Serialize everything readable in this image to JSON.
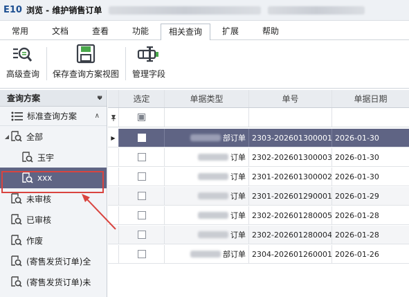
{
  "window": {
    "app_logo": "E10",
    "title": "浏览 - 维护销售订单"
  },
  "tabs": [
    "常用",
    "文档",
    "查看",
    "功能",
    "相关查询",
    "扩展",
    "帮助"
  ],
  "active_tab": "相关查询",
  "toolbar": {
    "advanced_query": "高级查询",
    "save_view": "保存查询方案视图",
    "manage_fields": "管理字段"
  },
  "left_panel": {
    "title": "查询方案",
    "pin": "ᵖ",
    "standard_scheme": "标准查询方案",
    "tree": [
      {
        "label": "全部",
        "level": 0,
        "expanded": true
      },
      {
        "label": "玉宇",
        "level": 1
      },
      {
        "label": "xxx",
        "level": 1,
        "selected": true
      },
      {
        "label": "未审核",
        "level": 0
      },
      {
        "label": "已审核",
        "level": 0
      },
      {
        "label": "作废",
        "level": 0
      },
      {
        "label": "(寄售发货订单)全",
        "level": 0
      },
      {
        "label": "(寄售发货订单)未",
        "level": 0
      }
    ]
  },
  "grid": {
    "columns": [
      "选定",
      "单据类型",
      "单号",
      "单据日期"
    ],
    "rows": [
      {
        "type_suffix": "部订单",
        "number": "2303-202601300001",
        "date": "2026-01-30",
        "active": true
      },
      {
        "type_suffix": "订单",
        "number": "2302-202601300003",
        "date": "2026-01-30"
      },
      {
        "type_suffix": "订单",
        "number": "2301-202601300002",
        "date": "2026-01-30"
      },
      {
        "type_suffix": "订单",
        "number": "2301-202601290001",
        "date": "2026-01-29"
      },
      {
        "type_suffix": "订单",
        "number": "2302-202601280005",
        "date": "2026-01-28"
      },
      {
        "type_suffix": "订单",
        "number": "2302-202601280004",
        "date": "2026-01-28"
      },
      {
        "type_suffix": "部订单",
        "number": "2304-202601260001",
        "date": "2026-01-26"
      }
    ]
  },
  "colors": {
    "selection": "#5f6484",
    "annotation": "#d9443f"
  }
}
